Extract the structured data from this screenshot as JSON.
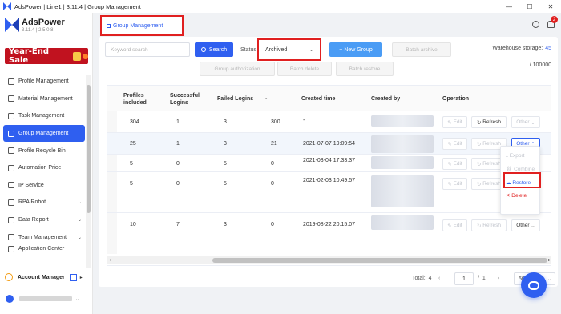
{
  "window": {
    "title": "AdsPower | Line1 | 3.11.4 | Group Management",
    "controls": [
      "—",
      "☐",
      "✕"
    ]
  },
  "brand": {
    "name": "AdsPower",
    "version": "3.11.4 | 2.5.0.8"
  },
  "promo": {
    "label": "Year-End Sale"
  },
  "sidebar": {
    "items": [
      {
        "label": "Profile Management",
        "icon": "profile-icon"
      },
      {
        "label": "Material Management",
        "icon": "material-icon"
      },
      {
        "label": "Task Management",
        "icon": "task-icon"
      },
      {
        "label": "Group Management",
        "icon": "group-icon",
        "active": true
      },
      {
        "label": "Profile Recycle Bin",
        "icon": "recycle-bin-icon"
      },
      {
        "label": "Automation Price",
        "icon": "automation-icon"
      },
      {
        "label": "IP Service",
        "icon": "ip-icon"
      },
      {
        "label": "RPA Robot",
        "icon": "robot-icon",
        "chevron": "⌄"
      },
      {
        "label": "Data Report",
        "icon": "report-icon",
        "chevron": "⌄"
      },
      {
        "label": "Team Management",
        "icon": "team-icon",
        "chevron": "⌄"
      },
      {
        "label": "Application Center",
        "icon": "app-center-icon"
      }
    ],
    "account_manager": "Account Manager"
  },
  "breadcrumb": {
    "label": "Group Management"
  },
  "notifications": {
    "count": "2"
  },
  "toolbar": {
    "search_placeholder": "Keyword search",
    "search_label": "Search",
    "status_label": "Status",
    "status_value": "Archived",
    "new_group_label": "+ New Group",
    "batch_archive_label": "Batch archive",
    "group_authorization_label": "Group authorization",
    "batch_delete_label": "Batch delete",
    "batch_restore_label": "Batch restore"
  },
  "storage": {
    "label": "Warehouse storage:",
    "used": "45",
    "total": "/ 100000"
  },
  "table": {
    "headers": {
      "profiles": "Profiles included",
      "logins": "Successful Logins",
      "failed": "Failed Logins",
      "dash": "-",
      "created_time": "Created time",
      "created_by": "Created by",
      "operation": "Operation"
    },
    "rows": [
      {
        "profiles": "304",
        "logins": "1",
        "failed": "3",
        "dash": "300",
        "created_time": "-"
      },
      {
        "profiles": "25",
        "logins": "1",
        "failed": "3",
        "dash": "21",
        "created_time": "2021-07-07 19:09:54"
      },
      {
        "profiles": "5",
        "logins": "0",
        "failed": "5",
        "dash": "0",
        "created_time": "2021-03-04 17:33:37"
      },
      {
        "profiles": "5",
        "logins": "0",
        "failed": "5",
        "dash": "0",
        "created_time": "2021-02-03 10:49:57"
      },
      {
        "profiles": "10",
        "logins": "7",
        "failed": "3",
        "dash": "0",
        "created_time": "2019-08-22 20:15:07"
      }
    ],
    "op_edit": "Edit",
    "op_refresh": "Refresh",
    "op_other": "Other"
  },
  "other_menu": {
    "export": "Export",
    "combine": "Combine",
    "restore": "Restore",
    "delete": "Delete"
  },
  "pagination": {
    "total_label": "Total:",
    "total": "4",
    "prev": "‹",
    "next": "›",
    "page": "1",
    "of": "/",
    "pages": "1",
    "per_page": "50 /Page"
  },
  "colors": {
    "accent": "#2f5ff0",
    "highlight_border": "#e02020",
    "promo_bg": "#c1121f"
  }
}
